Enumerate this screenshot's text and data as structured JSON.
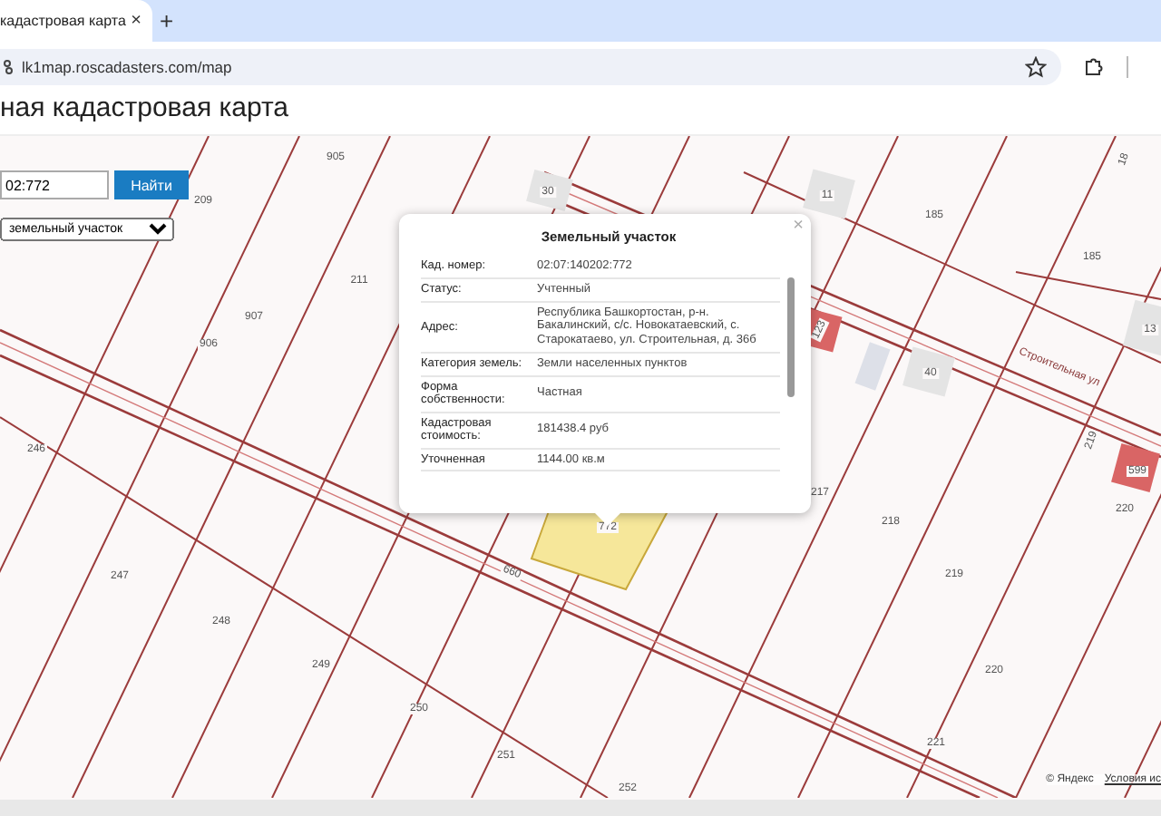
{
  "browser": {
    "tab": {
      "title": "кадастровая карта",
      "close": "×",
      "selected": true
    },
    "new_tab": "+",
    "url": "lk1map.roscadasters.com/map"
  },
  "page_title": "ная кадастровая карта",
  "search": {
    "value": "02:772",
    "button": "Найти"
  },
  "layer_select": {
    "value": "земельный участок"
  },
  "map": {
    "parcel_labels": [
      "905",
      "209",
      "906",
      "907",
      "211",
      "30",
      "11",
      "185",
      "185",
      "13",
      "40",
      "123",
      "219",
      "599",
      "220",
      "217",
      "218",
      "219",
      "220",
      "221",
      "246",
      "247",
      "248",
      "249",
      "250",
      "251",
      "252",
      "660",
      "772",
      "18"
    ],
    "street_label": "Строительная ул",
    "attribution": "© Яндекс",
    "terms_link": "Условия ис"
  },
  "popup": {
    "title": "Земельный участок",
    "close": "×",
    "rows": [
      {
        "label": "Кад. номер:",
        "value": "02:07:140202:772"
      },
      {
        "label": "Статус:",
        "value": "Учтенный"
      },
      {
        "label": "Адрес:",
        "value": "Республика Башкортостан, р-н. Бакалинский, с/с. Новокатаевский, с. Старокатаево, ул. Строительная, д. 36б"
      },
      {
        "label": "Категория земель:",
        "value": "Земли населенных пунктов"
      },
      {
        "label": "Форма собственности:",
        "value": "Частная"
      },
      {
        "label": "Кадастровая стоимость:",
        "value": "181438.4 руб"
      },
      {
        "label": "Уточненная",
        "value": "1144.00 кв.м"
      }
    ]
  }
}
